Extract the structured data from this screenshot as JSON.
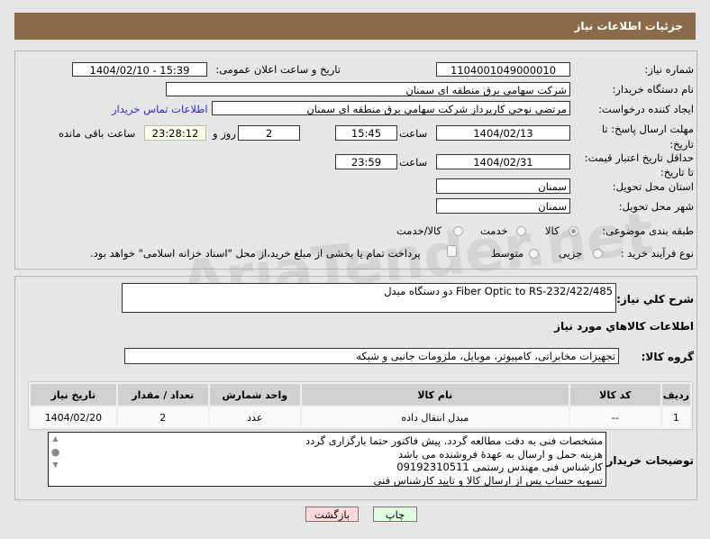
{
  "header": {
    "title": "جزئیات اطلاعات نیاز"
  },
  "form": {
    "need_number_label": "شماره نیاز:",
    "need_number": "1104001049000010",
    "announce_label": "تاریخ و ساعت اعلان عمومی:",
    "announce_value": "1404/02/10 - 15:39",
    "buyer_label": "نام دستگاه خریدار:",
    "buyer": "شرکت سهامی برق منطقه ای سمنان",
    "creator_label": "ایجاد کننده درخواست:",
    "creator": "مرتضی نوحی کارپرداز شرکت سهامی برق منطقه ای سمنان",
    "contact_link": "اطلاعات تماس خریدار",
    "deadline_label_1": "مهلت ارسال پاسخ: تا",
    "deadline_label_2": "تاریخ:",
    "deadline_date": "1404/02/13",
    "time_label": "ساعت",
    "deadline_time": "15:45",
    "days": "2",
    "days_label": "روز و",
    "remaining": "23:28:12",
    "remaining_label": "ساعت باقی مانده",
    "validity_label_1": "حداقل تاریخ اعتبار قیمت:",
    "validity_label_2": "تا تاریخ:",
    "validity_date": "1404/02/31",
    "validity_time": "23:59",
    "province_label": "استان محل تحویل:",
    "province": "سمنان",
    "city_label": "شهر محل تحویل:",
    "city": "سمنان",
    "category_label": "طبقه بندی موضوعی:",
    "category_options": [
      "کالا",
      "خدمت",
      "کالا/خدمت"
    ],
    "process_label": "نوع فرآیند خرید :",
    "process_options": [
      "جزیی",
      "متوسط"
    ],
    "payment_note": "پرداخت تمام یا بخشی از مبلغ خرید،از محل \"اسناد خزانه اسلامی\" خواهد بود."
  },
  "details": {
    "desc_label": "شرح کلي نياز:",
    "desc": "دو دستگاه مبدل Fiber Optic to RS-232/422/485",
    "goods_heading": "اطلاعات کالاهاي مورد نياز",
    "group_label": "گروه کالا:",
    "group": "تجهیزات مخابراتی، کامپیوتر، موبایل، ملزومات جانبی و شبکه",
    "columns": [
      "ردیف",
      "کد کالا",
      "نام کالا",
      "واحد شمارش",
      "تعداد / مقدار",
      "تاریخ نیاز"
    ],
    "rows": [
      [
        "1",
        "--",
        "مبدل انتقال داده",
        "عدد",
        "2",
        "1404/02/20"
      ]
    ],
    "notes_label": "توضیحات خریدار:",
    "notes": [
      "مشخصات فنی به دقت مطالعه گردد. پیش فاکتور حتما بارگزاری گردد",
      "هزینه حمل و ارسال به عهدهٔ فروشنده می باشد",
      "کارشناس فنی مهندس رستمی 09192310511",
      "تسویه حساب پس از ارسال کالا و تایید کارشناس فنی"
    ]
  },
  "buttons": {
    "back": "بازگشت",
    "print": "چاپ"
  },
  "watermark": "AriaTender.net"
}
